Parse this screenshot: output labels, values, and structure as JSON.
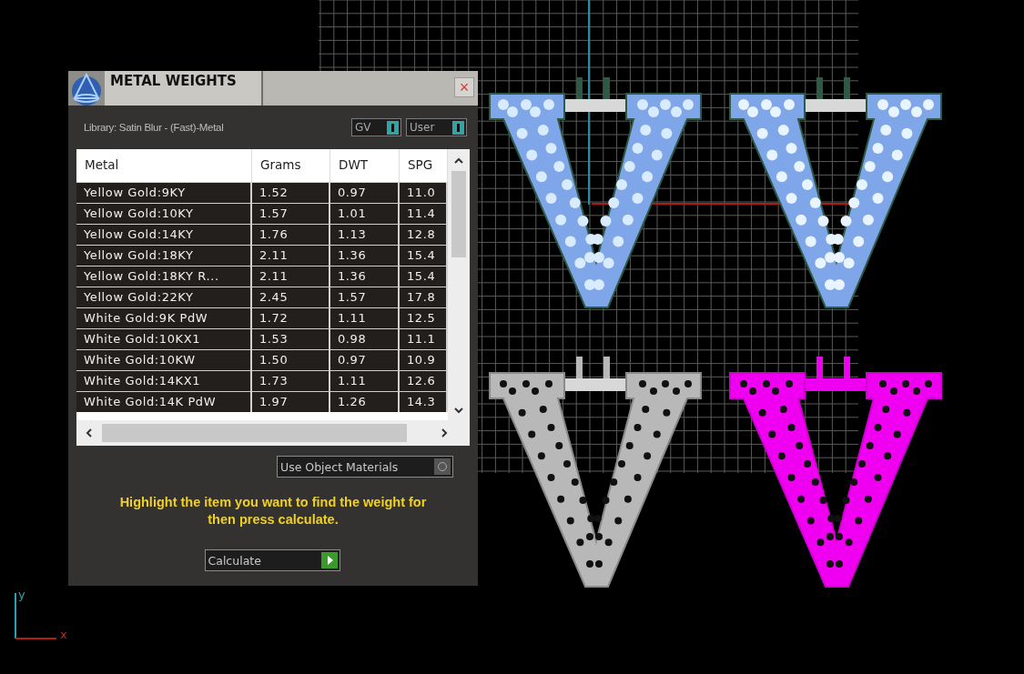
{
  "dialog": {
    "title": "METAL WEIGHTS",
    "close_label": "×",
    "library": "Library: Satin Blur - (Fast)-Metal",
    "toggles": [
      {
        "label": "GV",
        "on": true
      },
      {
        "label": "User",
        "on": true
      }
    ],
    "table": {
      "columns": [
        "Metal",
        "Grams",
        "DWT",
        "SPG"
      ],
      "rows": [
        [
          "Yellow Gold:9KY",
          "1.52",
          "0.97",
          "11.0"
        ],
        [
          "Yellow Gold:10KY",
          "1.57",
          "1.01",
          "11.4"
        ],
        [
          "Yellow Gold:14KY",
          "1.76",
          "1.13",
          "12.8"
        ],
        [
          "Yellow Gold:18KY",
          "2.11",
          "1.36",
          "15.4"
        ],
        [
          "Yellow Gold:18KY R...",
          "2.11",
          "1.36",
          "15.4"
        ],
        [
          "Yellow Gold:22KY",
          "2.45",
          "1.57",
          "17.8"
        ],
        [
          "White Gold:9K PdW",
          "1.72",
          "1.11",
          "12.5"
        ],
        [
          "White Gold:10KX1",
          "1.53",
          "0.98",
          "11.1"
        ],
        [
          "White Gold:10KW",
          "1.50",
          "0.97",
          "10.9"
        ],
        [
          "White Gold:14KX1",
          "1.73",
          "1.11",
          "12.6"
        ],
        [
          "White Gold:14K PdW",
          "1.97",
          "1.26",
          "14.3"
        ]
      ]
    },
    "use_object_materials": {
      "label": "Use Object Materials",
      "checked": false
    },
    "message": "Highlight the item you want to find the weight for then press calculate.",
    "calculate_button": "Calculate"
  },
  "axes": {
    "y_label": "y",
    "x_label": "x"
  }
}
